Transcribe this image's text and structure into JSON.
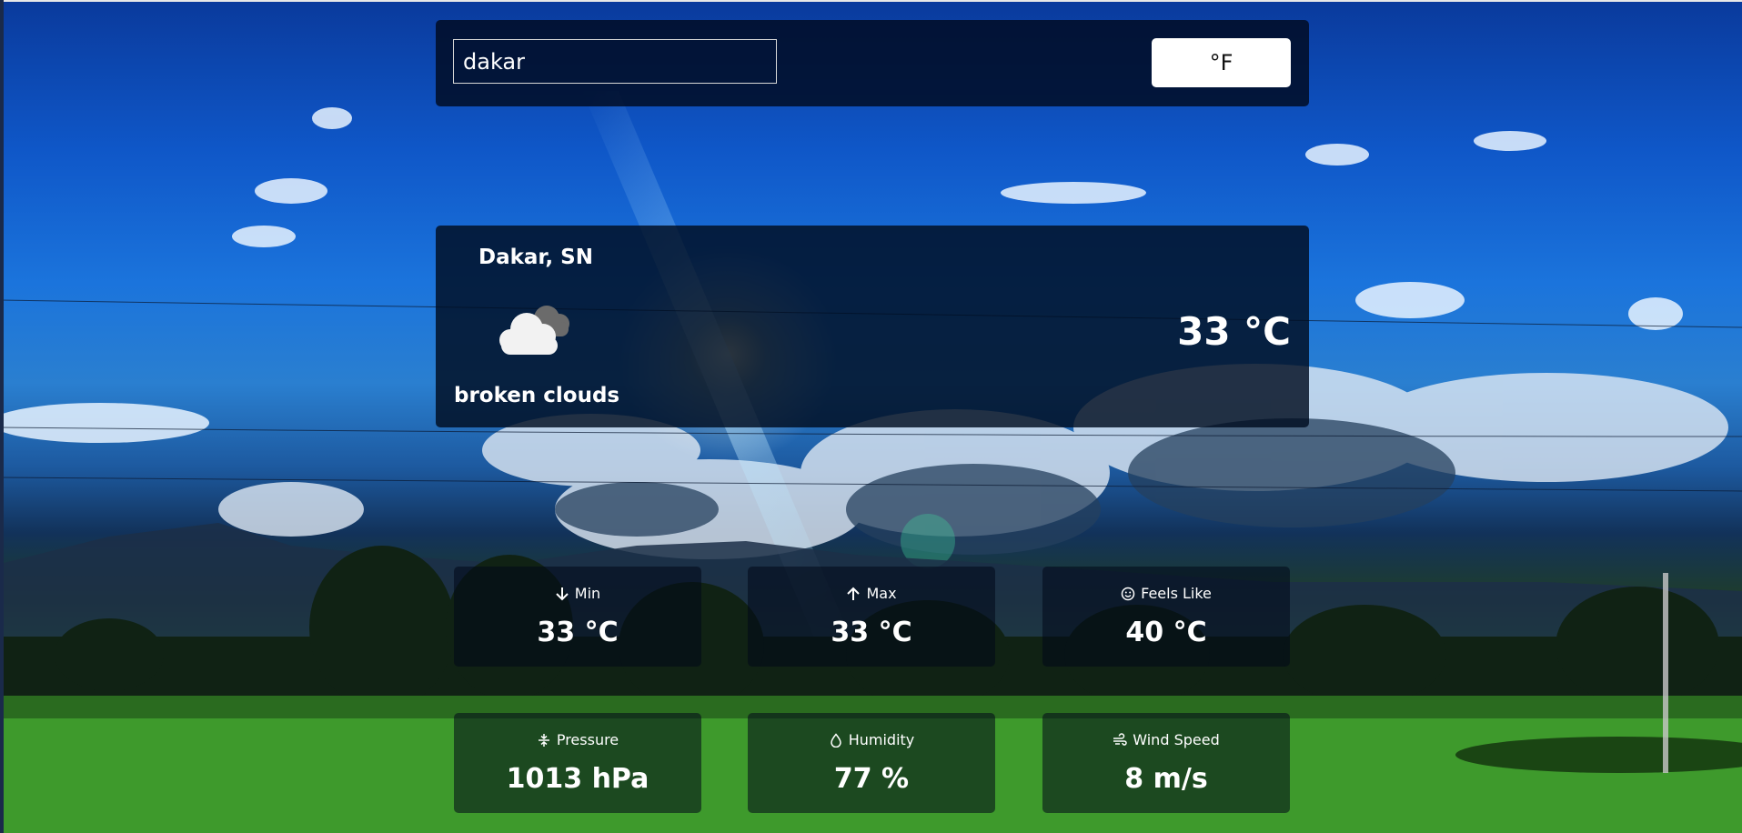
{
  "search": {
    "value": "dakar"
  },
  "unit_toggle": {
    "label": "°F"
  },
  "current": {
    "city": "Dakar, SN",
    "icon": "broken-clouds-icon",
    "description": "broken clouds",
    "temperature": "33 °C"
  },
  "stats": [
    {
      "icon": "arrow-down-icon",
      "label": "Min",
      "value": "33 °C"
    },
    {
      "icon": "arrow-up-icon",
      "label": "Max",
      "value": "33 °C"
    },
    {
      "icon": "smiley-icon",
      "label": "Feels Like",
      "value": "40 °C"
    },
    {
      "icon": "pressure-icon",
      "label": "Pressure",
      "value": "1013 hPa"
    },
    {
      "icon": "droplet-icon",
      "label": "Humidity",
      "value": "77 %"
    },
    {
      "icon": "wind-icon",
      "label": "Wind Speed",
      "value": "8 m/s"
    }
  ],
  "colors": {
    "panel": "#000c20",
    "text": "#ffffff",
    "button_bg": "#ffffff"
  }
}
